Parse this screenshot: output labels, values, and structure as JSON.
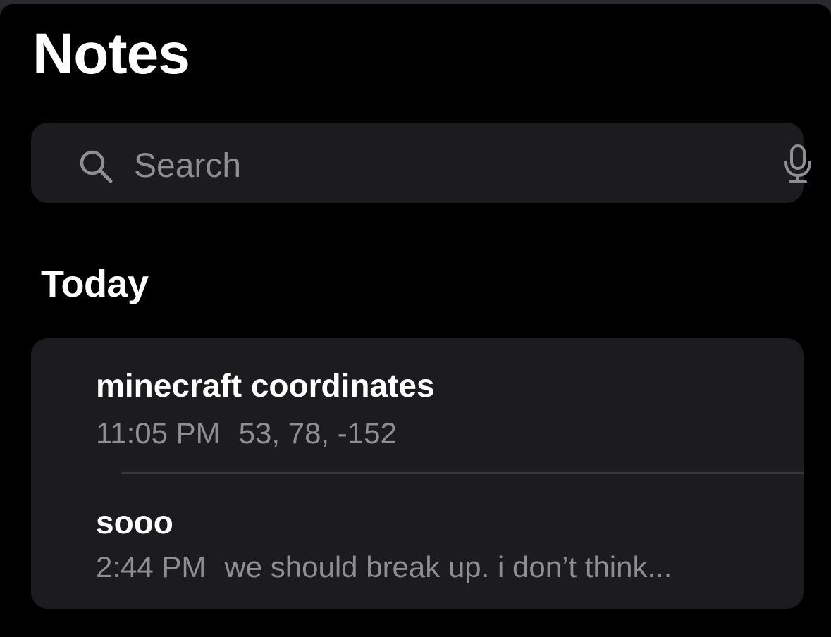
{
  "app": {
    "title": "Notes"
  },
  "search": {
    "placeholder": "Search",
    "value": ""
  },
  "section": {
    "header": "Today"
  },
  "notes": [
    {
      "title": "minecraft coordinates",
      "time": "11:05 PM",
      "preview": "53, 78, -152"
    },
    {
      "title": "sooo",
      "time": "2:44 PM",
      "preview": "we should break up. i don’t think..."
    }
  ],
  "icons": {
    "search": "magnifying-glass",
    "mic": "microphone"
  },
  "colors": {
    "background": "#000000",
    "card": "#1c1c1e",
    "primary_text": "#ffffff",
    "secondary_text": "#8e8e93",
    "separator": "#38383a"
  }
}
